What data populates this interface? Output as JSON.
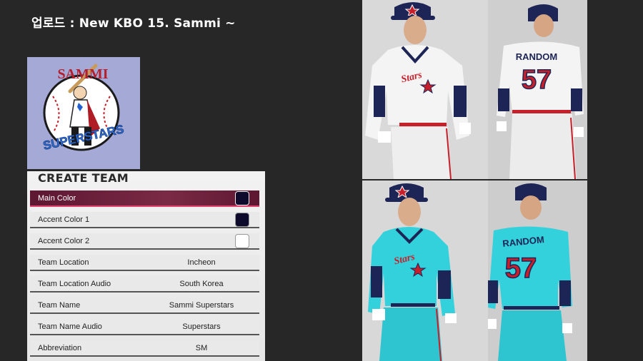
{
  "post": {
    "title": "업로드 : New KBO 15. Sammi ~"
  },
  "logo": {
    "top_text": "SAMMI",
    "bottom_text": "SUPERSTARS"
  },
  "panel": {
    "title": "CREATE TEAM",
    "rows": [
      {
        "label": "Main Color",
        "swatch": "#0d0a2b",
        "selected": true
      },
      {
        "label": "Accent Color 1",
        "swatch": "#0d0a2b"
      },
      {
        "label": "Accent Color 2",
        "swatch": "#ffffff"
      },
      {
        "label": "Team Location",
        "value": "Incheon"
      },
      {
        "label": "Team Location Audio",
        "value": "South Korea"
      },
      {
        "label": "Team Name",
        "value": "Sammi Superstars"
      },
      {
        "label": "Team Name Audio",
        "value": "Superstars"
      },
      {
        "label": "Abbreviation",
        "value": "SM"
      }
    ]
  },
  "uniforms": {
    "back_name": "RANDOM",
    "back_number": "57",
    "home_jersey_color": "#f4f4f4",
    "away_jersey_color": "#32d1dc",
    "trim_navy": "#1d2556",
    "trim_red": "#c8202a"
  }
}
